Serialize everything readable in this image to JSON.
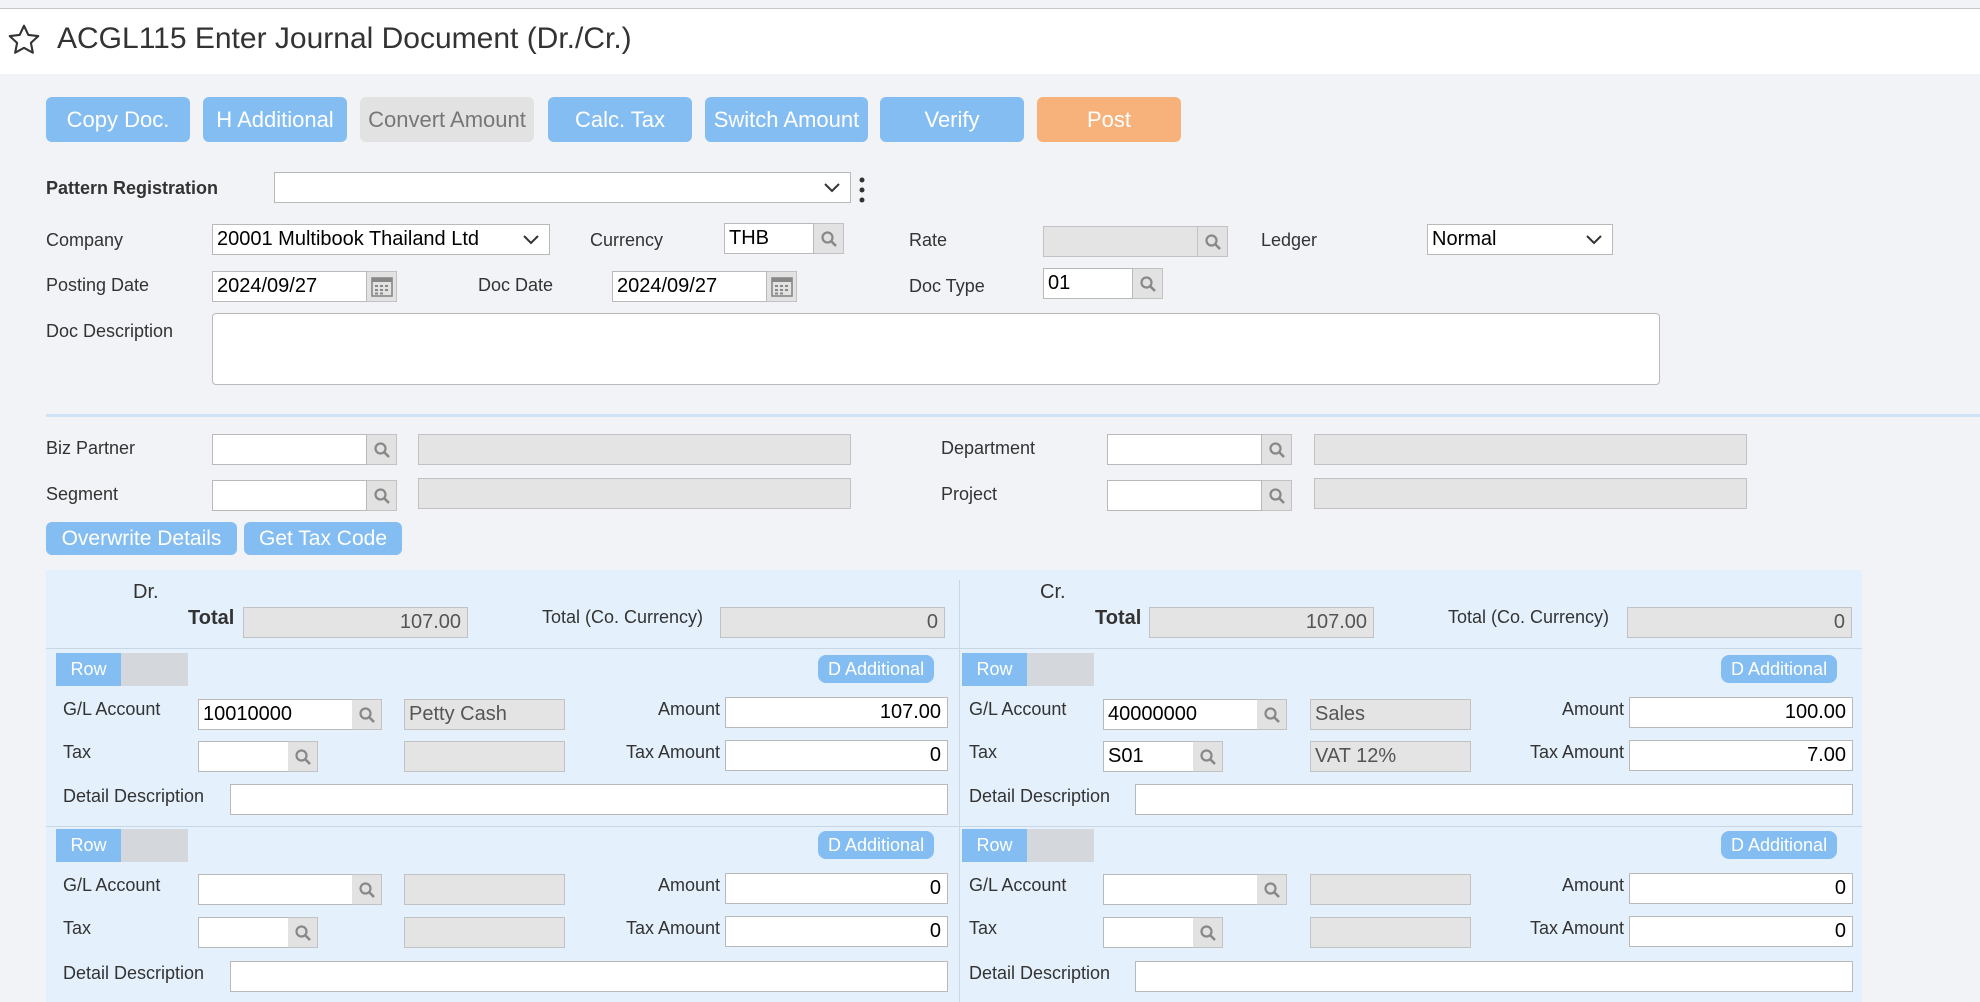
{
  "header": {
    "title": "ACGL115 Enter Journal Document (Dr./Cr.)"
  },
  "toolbar": {
    "copy_doc": "Copy Doc.",
    "h_additional": "H Additional",
    "convert_amount": "Convert Amount",
    "calc_tax": "Calc. Tax",
    "switch_amount": "Switch Amount",
    "verify": "Verify",
    "post": "Post"
  },
  "form": {
    "pattern_registration_label": "Pattern Registration",
    "pattern_registration_value": "",
    "company_label": "Company",
    "company_value": "20001 Multibook Thailand Ltd",
    "currency_label": "Currency",
    "currency_value": "THB",
    "rate_label": "Rate",
    "rate_value": "",
    "ledger_label": "Ledger",
    "ledger_value": "Normal",
    "posting_date_label": "Posting Date",
    "posting_date_value": "2024/09/27",
    "doc_date_label": "Doc Date",
    "doc_date_value": "2024/09/27",
    "doc_type_label": "Doc Type",
    "doc_type_value": "01",
    "doc_description_label": "Doc Description",
    "doc_description_value": ""
  },
  "header_details": {
    "biz_partner_label": "Biz Partner",
    "segment_label": "Segment",
    "department_label": "Department",
    "project_label": "Project",
    "overwrite_details": "Overwrite Details",
    "get_tax_code": "Get Tax Code"
  },
  "labels": {
    "total": "Total",
    "total_co": "Total (Co. Currency)",
    "row": "Row",
    "d_additional": "D Additional",
    "gl_account": "G/L Account",
    "amount": "Amount",
    "tax": "Tax",
    "tax_amount": "Tax Amount",
    "detail_description": "Detail Description"
  },
  "debit": {
    "heading": "Dr.",
    "total": "107.00",
    "total_co": "0",
    "rows": [
      {
        "gl_account": "10010000",
        "gl_name": "Petty Cash",
        "amount": "107.00",
        "tax": "",
        "tax_name": "",
        "tax_amount": "0",
        "detail": ""
      },
      {
        "gl_account": "",
        "gl_name": "",
        "amount": "0",
        "tax": "",
        "tax_name": "",
        "tax_amount": "0",
        "detail": ""
      }
    ]
  },
  "credit": {
    "heading": "Cr.",
    "total": "107.00",
    "total_co": "0",
    "rows": [
      {
        "gl_account": "40000000",
        "gl_name": "Sales",
        "amount": "100.00",
        "tax": "S01",
        "tax_name": "VAT 12%",
        "tax_amount": "7.00",
        "detail": ""
      },
      {
        "gl_account": "",
        "gl_name": "",
        "amount": "0",
        "tax": "",
        "tax_name": "",
        "tax_amount": "0",
        "detail": ""
      }
    ]
  }
}
